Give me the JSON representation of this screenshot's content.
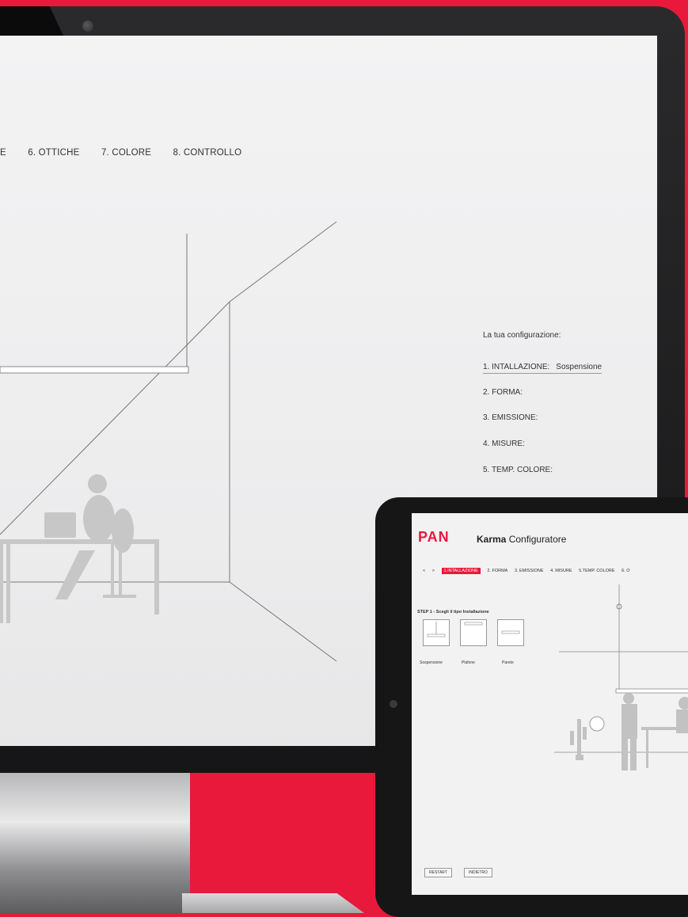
{
  "desktop": {
    "steps": [
      "E",
      "6. OTTICHE",
      "7. COLORE",
      "8. CONTROLLO"
    ],
    "config": {
      "title": "La tua configurazione:",
      "rows": [
        {
          "label": "1. INTALLAZIONE:",
          "value": "Sospensione"
        },
        {
          "label": "2. FORMA:",
          "value": ""
        },
        {
          "label": "3. EMISSIONE:",
          "value": ""
        },
        {
          "label": "4. MISURE:",
          "value": ""
        },
        {
          "label": "5. TEMP. COLORE:",
          "value": ""
        }
      ]
    }
  },
  "tablet": {
    "logo": "PAN",
    "app_name": "Karma",
    "app_subtitle": "Configuratore",
    "nav": {
      "prev": "<",
      "next": ">",
      "tabs": [
        "1.INTALLAZIONE",
        "2. FORMA",
        "3. EMISSIONE",
        "4. MISURE",
        "5.TEMP. COLORE",
        "6. O"
      ]
    },
    "step_title": "STEP 1 - Scegli il tipo Installazione",
    "options": [
      "Sospensione",
      "Plafone",
      "Parete"
    ],
    "buttons": {
      "restart": "RESTART",
      "back": "INDIETRO"
    }
  },
  "colors": {
    "brand_red": "#e8193a",
    "screen_bg": "#efeff0",
    "bezel": "#1b1b1c"
  }
}
